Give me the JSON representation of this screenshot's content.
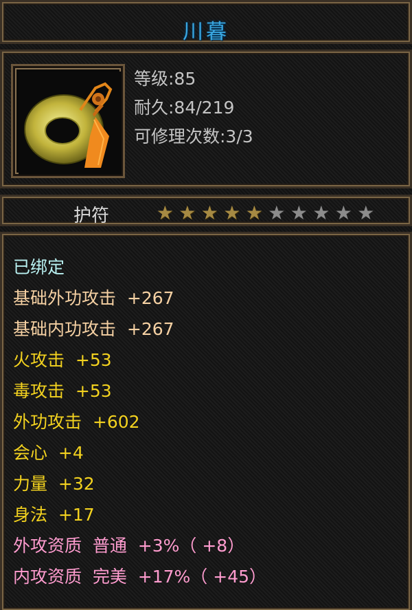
{
  "item_name": "川暮",
  "icon_name": "jade-amulet-icon",
  "level": "等级:85",
  "durability": "耐久:84/219",
  "repairs": "可修理次数:3/3",
  "item_type": "护符",
  "star_rating": 5,
  "star_max": 10,
  "bound_status": "已绑定",
  "base_stats": [
    "基础外功攻击  +267",
    "基础内功攻击  +267"
  ],
  "attributes": [
    "火攻击  +53",
    "毒攻击  +53",
    "外功攻击  +602",
    "会心  +4",
    "力量  +32",
    "身法  +17"
  ],
  "aptitudes": [
    "外攻资质  普通  +3%（ +8）",
    "内攻资质  完美  +17%（ +45）"
  ],
  "colors": {
    "title": "#3aa7e0",
    "bound": "#b8f0f0",
    "base": "#f6d1a3",
    "attribute": "#f3d21f",
    "aptitude": "#ff9ccf",
    "star_on": "#a68a43",
    "star_off": "#8c8c8c"
  }
}
